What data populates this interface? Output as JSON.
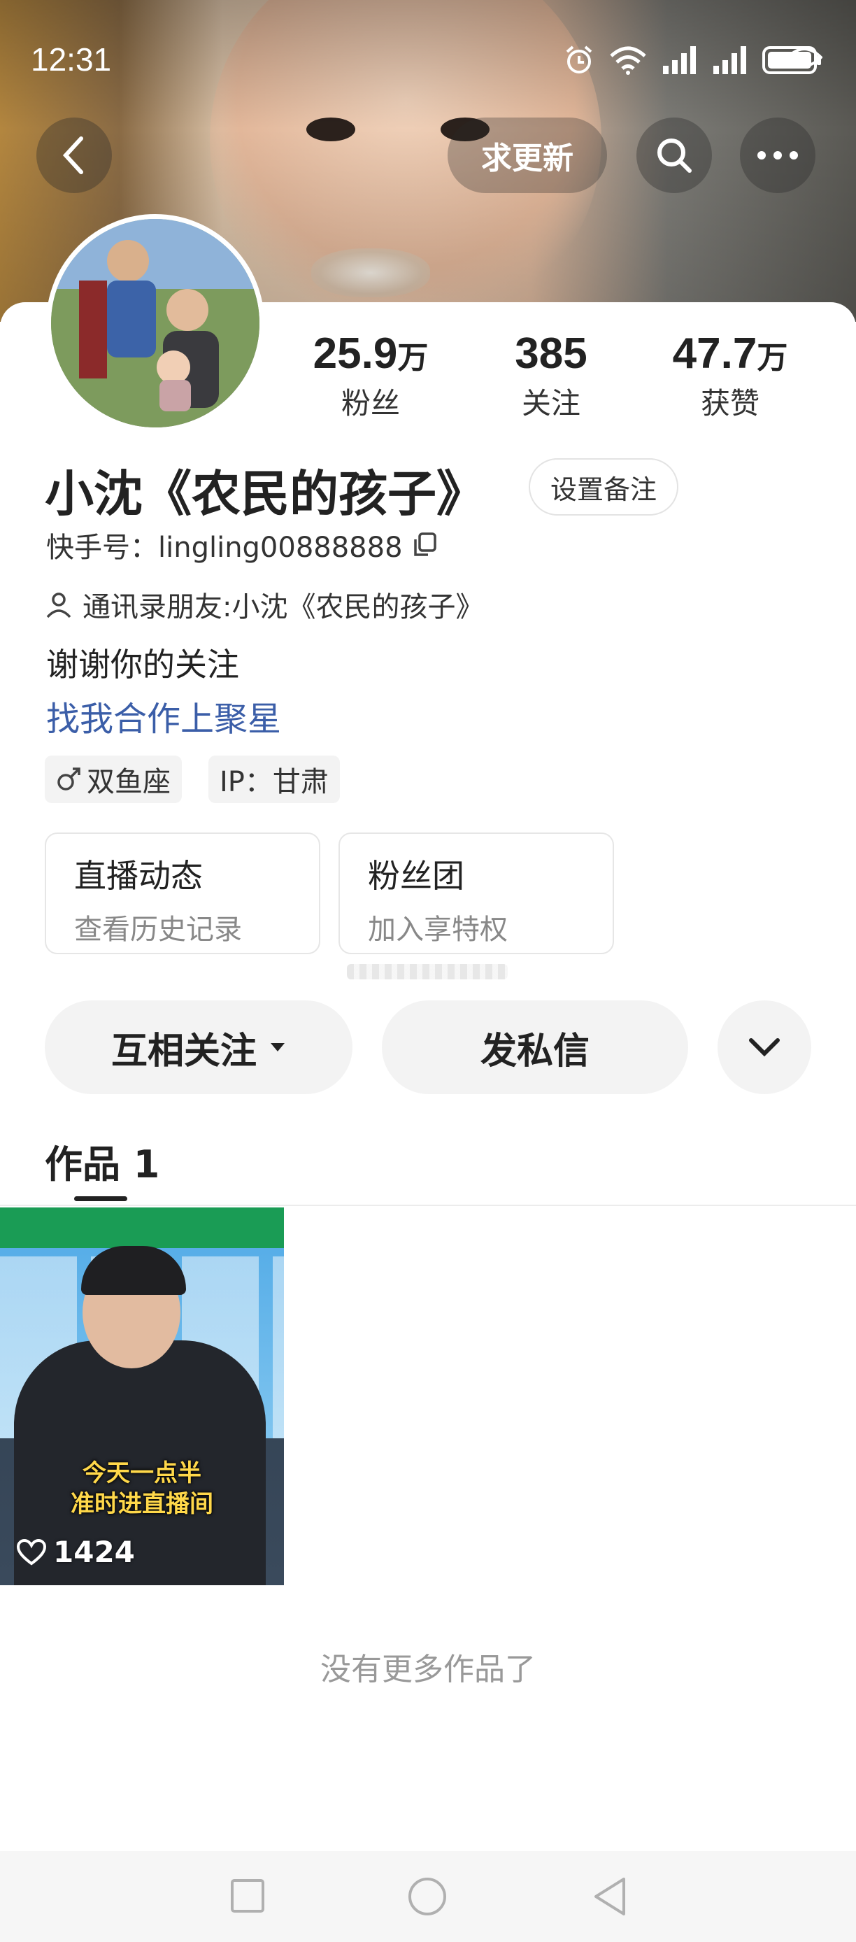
{
  "status_bar": {
    "time": "12:31"
  },
  "header": {
    "update_button": "求更新"
  },
  "profile": {
    "name": "小沈《农民的孩子》",
    "remark_button": "设置备注",
    "kuaishou_id": "快手号：lingling00888888",
    "contact_friend": "通讯录朋友:小沈《农民的孩子》",
    "bio": "谢谢你的关注",
    "link": "找我合作上聚星",
    "tags": {
      "zodiac": "双鱼座",
      "ip": "IP：甘肃"
    }
  },
  "stats": {
    "fans": {
      "value": "25.9",
      "unit": "万",
      "label": "粉丝"
    },
    "following": {
      "value": "385",
      "label": "关注"
    },
    "likes": {
      "value": "47.7",
      "unit": "万",
      "label": "获赞"
    }
  },
  "features": [
    {
      "title": "直播动态",
      "subtitle": "查看历史记录"
    },
    {
      "title": "粉丝团",
      "subtitle": "加入享特权"
    }
  ],
  "actions": {
    "follow": "互相关注",
    "message": "发私信"
  },
  "tabs": {
    "works": "作品 1"
  },
  "video": {
    "caption_line1": "今天一点半",
    "caption_line2": "准时进直播间",
    "likes": "1424"
  },
  "footer": {
    "no_more": "没有更多作品了"
  }
}
